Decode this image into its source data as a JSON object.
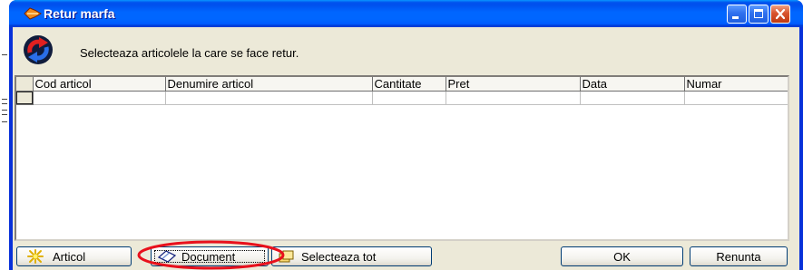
{
  "window": {
    "title": "Retur marfa",
    "icon": "cargo-icon",
    "controls": [
      "minimize-icon",
      "maximize-icon",
      "close-icon"
    ]
  },
  "header": {
    "icon": "return-arrows-icon",
    "message": "Selecteaza articolele la care se face retur."
  },
  "grid": {
    "columns": [
      "Cod articol",
      "Denumire articol",
      "Cantitate",
      "Pret",
      "Data",
      "Numar"
    ],
    "rows": [
      [
        "",
        "",
        "",
        "",
        "",
        ""
      ]
    ]
  },
  "buttons": {
    "articol": {
      "label": "Articol",
      "icon": "sparkle-icon"
    },
    "document": {
      "label": "Document",
      "icon": "eraser-icon"
    },
    "select_all": {
      "label": "Selecteaza tot",
      "icon": "pages-icon"
    },
    "ok": {
      "label": "OK"
    },
    "cancel": {
      "label": "Renunta"
    }
  },
  "colors": {
    "accent": "#0054e3",
    "face": "#ece9d8",
    "close": "#d8542e",
    "annotation": "#e8101c"
  }
}
